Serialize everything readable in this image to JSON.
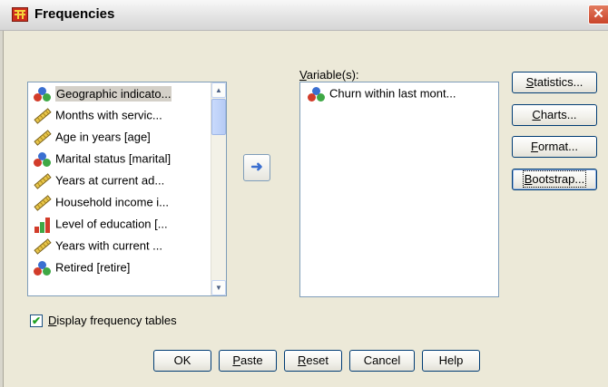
{
  "window": {
    "title": "Frequencies",
    "close_glyph": "✕"
  },
  "source_list": {
    "items": [
      {
        "label": "Geographic indicato...",
        "icon": "nominal",
        "selected": true
      },
      {
        "label": "Months with servic...",
        "icon": "scale"
      },
      {
        "label": "Age in years [age]",
        "icon": "scale"
      },
      {
        "label": "Marital status [marital]",
        "icon": "nominal"
      },
      {
        "label": "Years at current ad...",
        "icon": "scale"
      },
      {
        "label": "Household income i...",
        "icon": "scale"
      },
      {
        "label": "Level of education [...",
        "icon": "ordinal"
      },
      {
        "label": "Years with current ...",
        "icon": "scale"
      },
      {
        "label": "Retired [retire]",
        "icon": "nominal"
      }
    ]
  },
  "move_button": {
    "glyph": "➜"
  },
  "variables": {
    "label_accel": "V",
    "label_rest": "ariable(s):",
    "items": [
      {
        "label": "Churn within last mont...",
        "icon": "nominal"
      }
    ]
  },
  "side_buttons": {
    "statistics": {
      "accel": "S",
      "rest": "tatistics..."
    },
    "charts": {
      "accel": "C",
      "rest": "harts..."
    },
    "format": {
      "accel": "F",
      "rest": "ormat..."
    },
    "bootstrap": {
      "accel": "B",
      "rest": "ootstrap..."
    }
  },
  "display_freq": {
    "checked": true,
    "accel": "D",
    "rest": "isplay frequency tables"
  },
  "bottom_buttons": {
    "ok": "OK",
    "paste": {
      "accel": "P",
      "rest": "aste"
    },
    "reset": {
      "accel": "R",
      "rest": "eset"
    },
    "cancel": "Cancel",
    "help": "Help"
  },
  "colors": {
    "dialog_bg": "#ece9d8",
    "button_border": "#003c74",
    "list_border": "#7f9db9",
    "arrow": "#3b6fd0"
  }
}
